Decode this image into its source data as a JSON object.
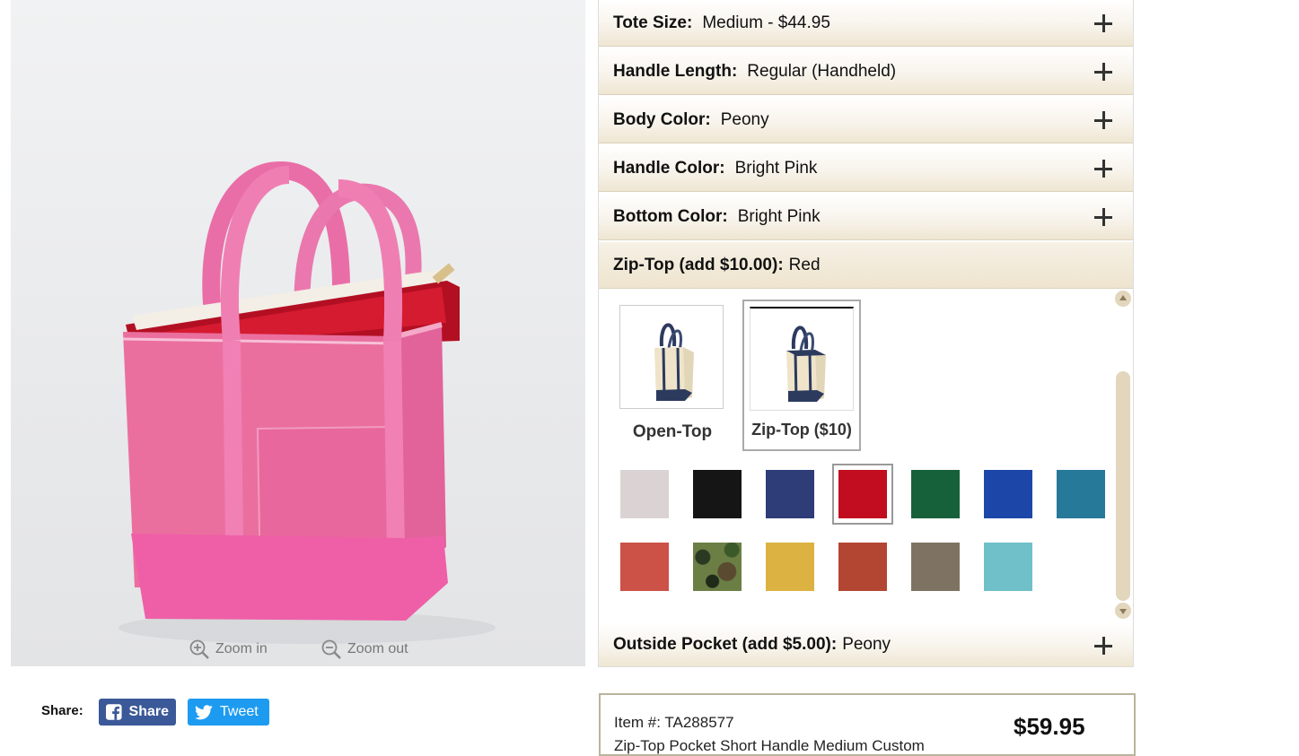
{
  "product": {
    "zoom_in_label": "Zoom in",
    "zoom_out_label": "Zoom out"
  },
  "share": {
    "label": "Share:",
    "facebook_label": "Share",
    "twitter_label": "Tweet"
  },
  "options": [
    {
      "label": "Tote Size:",
      "value": "Medium - $44.95"
    },
    {
      "label": "Handle Length:",
      "value": "Regular (Handheld)"
    },
    {
      "label": "Body Color:",
      "value": "Peony"
    },
    {
      "label": "Handle Color:",
      "value": "Bright Pink"
    },
    {
      "label": "Bottom Color:",
      "value": "Bright Pink"
    },
    {
      "label": "Zip-Top (add $10.00):",
      "value": "Red"
    },
    {
      "label": "Outside Pocket (add $5.00):",
      "value": "Peony"
    }
  ],
  "zip_panel": {
    "styles": [
      {
        "label": "Open-Top",
        "selected": false
      },
      {
        "label": "Zip-Top ($10)",
        "selected": true
      }
    ],
    "swatches": [
      {
        "color": "#dbd3d3",
        "selected": false
      },
      {
        "color": "#151515",
        "selected": false
      },
      {
        "color": "#2e3c78",
        "selected": false
      },
      {
        "color": "#c10d1f",
        "selected": true
      },
      {
        "color": "#17613a",
        "selected": false
      },
      {
        "color": "#1c47a8",
        "selected": false
      },
      {
        "color": "#27799a",
        "selected": false
      },
      {
        "color": "#cc5147",
        "selected": false
      },
      {
        "color": "camouflage",
        "selected": false
      },
      {
        "color": "#dcb342",
        "selected": false
      },
      {
        "color": "#b34633",
        "selected": false
      },
      {
        "color": "#7e7362",
        "selected": false
      },
      {
        "color": "#6fc0c8",
        "selected": false
      }
    ]
  },
  "summary": {
    "item_number": "Item #: TA288577",
    "description": "Zip-Top Pocket Short Handle Medium Custom",
    "price": "$59.95"
  }
}
